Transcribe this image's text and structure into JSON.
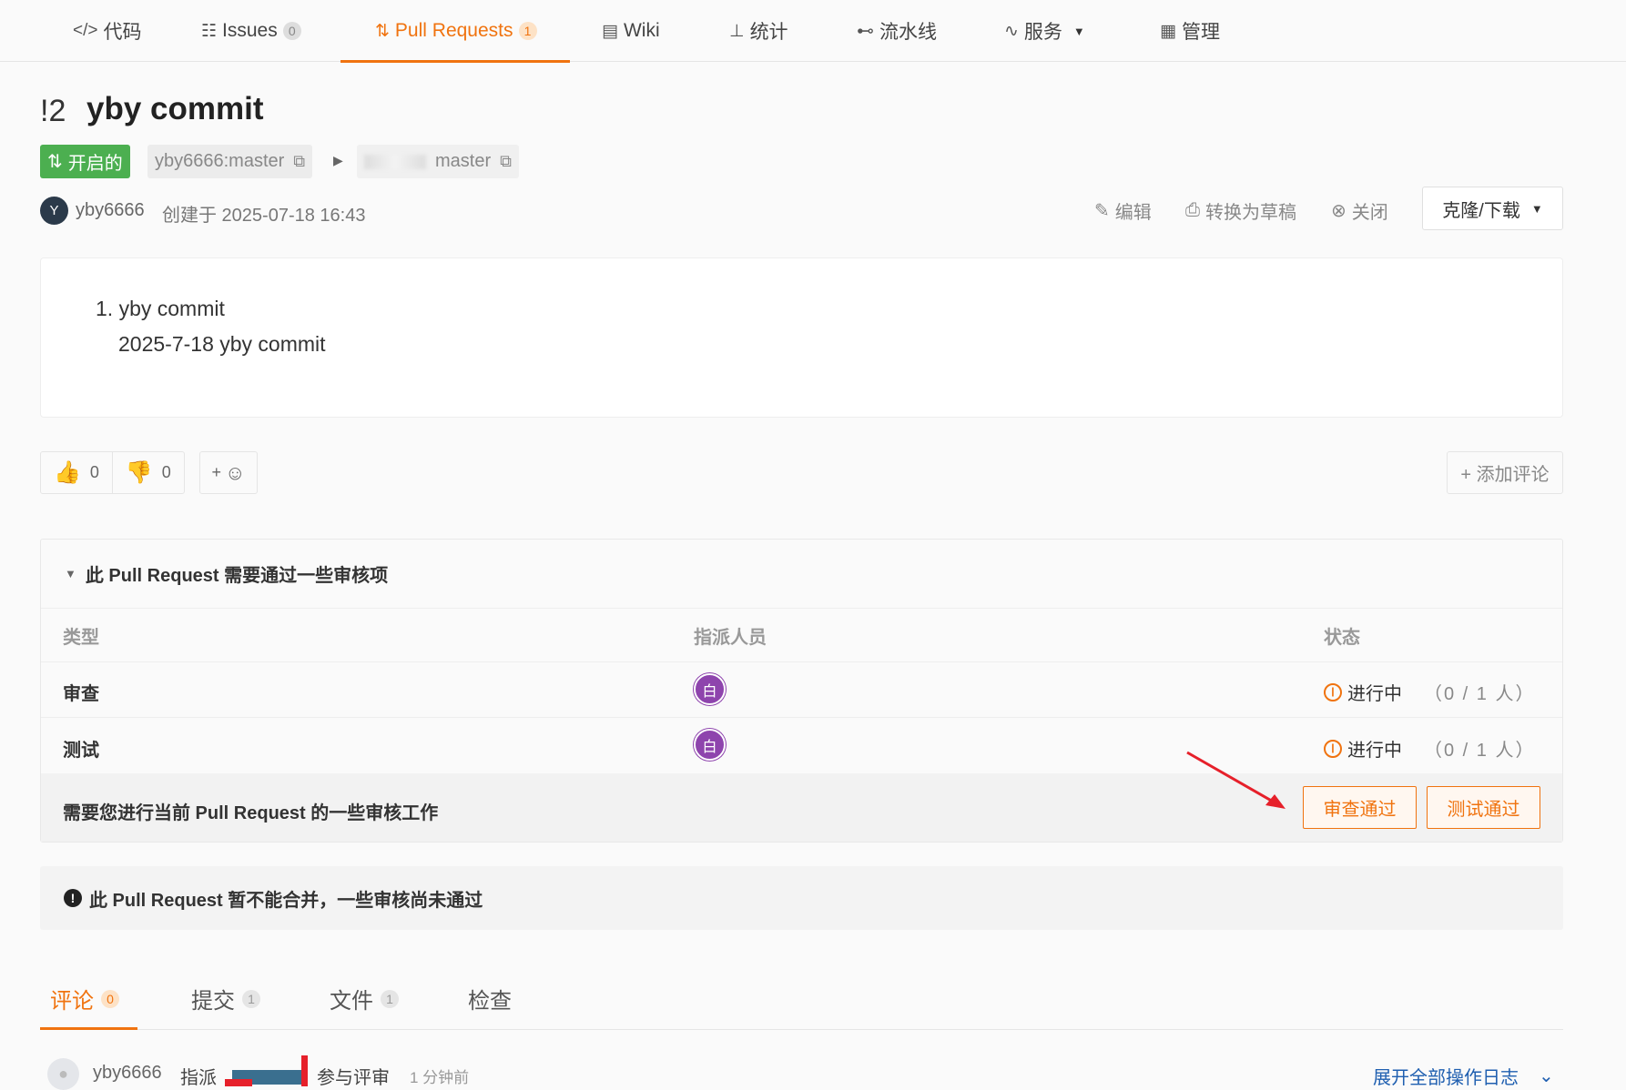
{
  "nav": {
    "items": [
      {
        "icon": "</>",
        "label": "代码"
      },
      {
        "icon": "☷",
        "label": "Issues",
        "badge": "0"
      },
      {
        "icon": "⇅",
        "label": "Pull Requests",
        "badge": "1"
      },
      {
        "icon": "▤",
        "label": "Wiki"
      },
      {
        "icon": "⊥",
        "label": "统计"
      },
      {
        "icon": "⊷",
        "label": "流水线"
      },
      {
        "icon": "∿",
        "label": "服务"
      },
      {
        "icon": "▦",
        "label": "管理"
      }
    ],
    "active": "Pull Requests",
    "accent_color": "#f0730f"
  },
  "pr": {
    "id": "!2",
    "title": "yby commit",
    "status": "开启的",
    "status_color": "#4caf50",
    "source_branch": "yby6666:master",
    "target_branch_visible": "master",
    "author_initial": "Y",
    "author": "yby6666",
    "created": "创建于 2025-07-18 16:43"
  },
  "actions": {
    "edit": "编辑",
    "to_draft": "转换为草稿",
    "close": "关闭",
    "clone": "克隆/下载"
  },
  "description": {
    "line1": "1. yby commit",
    "line2": "2025-7-18 yby commit"
  },
  "reactions": {
    "thumbs_up": "0",
    "thumbs_down": "0",
    "add_emoji": "+",
    "add_comment": "+ 添加评论"
  },
  "review": {
    "header": "此 Pull Request 需要通过一些审核项",
    "columns": [
      "类型",
      "指派人员",
      "状态"
    ],
    "rows": [
      {
        "type": "审查",
        "assignee_initial": "白",
        "state": "进行中",
        "count": "（0 / 1 人）"
      },
      {
        "type": "测试",
        "assignee_initial": "白",
        "state": "进行中",
        "count": "（0 / 1 人）"
      }
    ],
    "footer_text": "需要您进行当前 Pull Request 的一些审核工作",
    "approve_review": "审查通过",
    "approve_test": "测试通过"
  },
  "merge_warning": "此 Pull Request 暂不能合并，一些审核尚未通过",
  "tabs": [
    {
      "label": "评论",
      "count": "0"
    },
    {
      "label": "提交",
      "count": "1"
    },
    {
      "label": "文件",
      "count": "1"
    },
    {
      "label": "检查"
    }
  ],
  "activity": {
    "user": "yby6666",
    "verb": "指派",
    "suffix": "参与评审",
    "time": "1 分钟前",
    "expand": "展开全部操作日志"
  }
}
